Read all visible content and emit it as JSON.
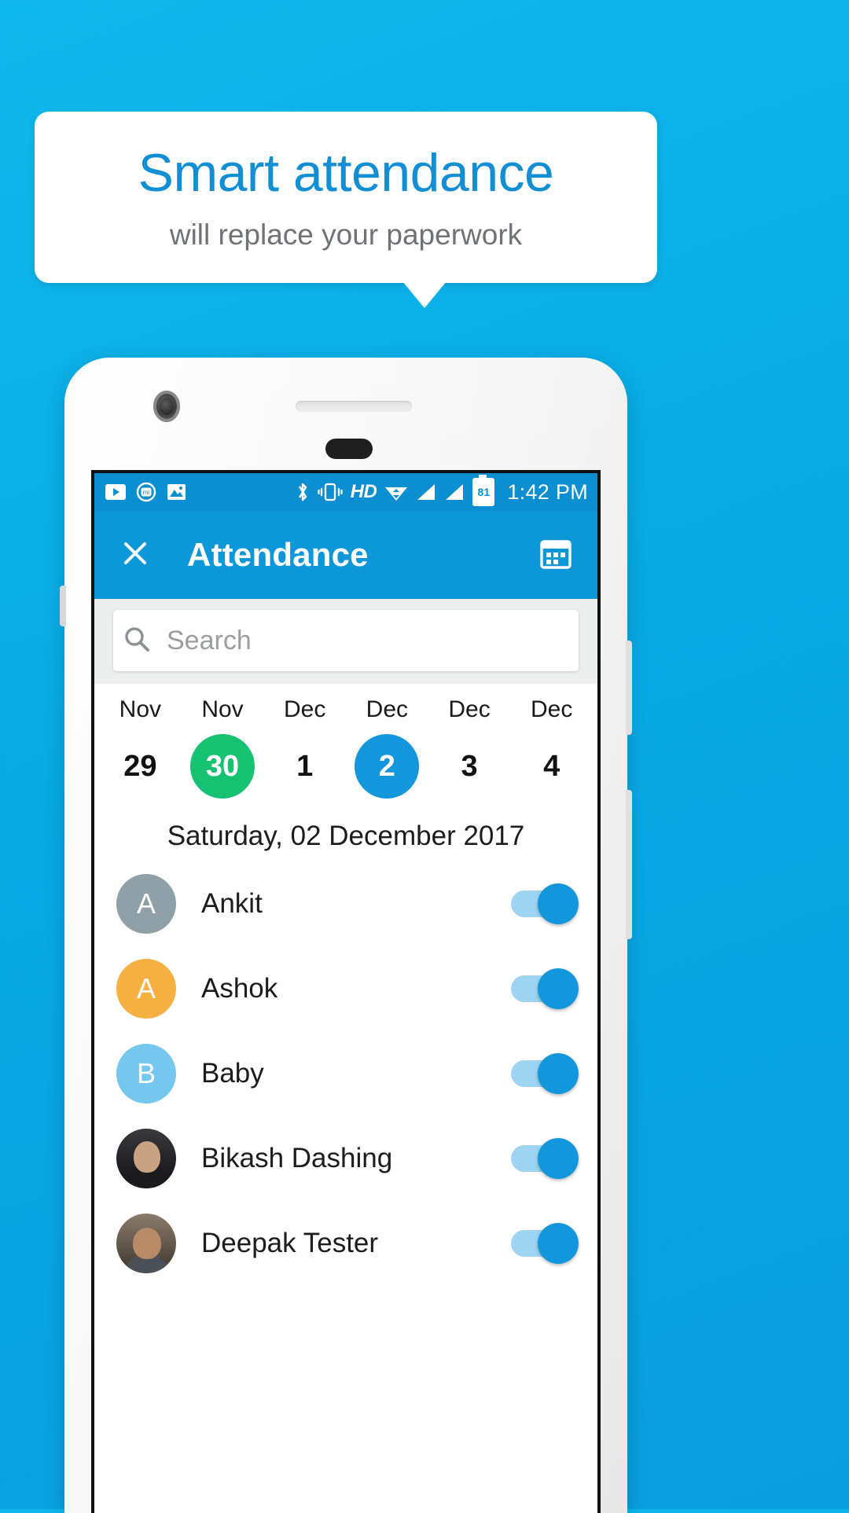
{
  "promo": {
    "headline": "Smart attendance",
    "subhead": "will replace your paperwork",
    "accent_color": "#128fd4",
    "background_color": "#0aaae4"
  },
  "status_bar": {
    "time": "1:42 PM",
    "battery_level": "81",
    "network_label": "HD",
    "left_icons": [
      "youtube-icon",
      "mi-camera-icon",
      "gallery-icon"
    ],
    "right_icons": [
      "bluetooth-icon",
      "vibrate-icon",
      "hd-icon",
      "wifi-icon",
      "signal-icon",
      "signal-icon",
      "battery-icon"
    ]
  },
  "app_bar": {
    "title": "Attendance",
    "close_icon": "close-icon",
    "calendar_icon": "calendar-icon",
    "background_color": "#0b97d8"
  },
  "search": {
    "placeholder": "Search",
    "value": "",
    "icon": "search-icon"
  },
  "date_strip": [
    {
      "month": "Nov",
      "day": "29",
      "state": "normal"
    },
    {
      "month": "Nov",
      "day": "30",
      "state": "today"
    },
    {
      "month": "Dec",
      "day": "1",
      "state": "normal"
    },
    {
      "month": "Dec",
      "day": "2",
      "state": "selected"
    },
    {
      "month": "Dec",
      "day": "3",
      "state": "normal"
    },
    {
      "month": "Dec",
      "day": "4",
      "state": "normal"
    }
  ],
  "selected_date_label": "Saturday, 02 December 2017",
  "colors": {
    "today_circle": "#16c172",
    "selected_circle": "#1496dc",
    "toggle_on_track": "#9ed4f2",
    "toggle_on_knob": "#1496dc"
  },
  "people": [
    {
      "name": "Ankit",
      "initial": "A",
      "avatar_type": "initial",
      "avatar_color": "#8fa0a8",
      "present": true
    },
    {
      "name": "Ashok",
      "initial": "A",
      "avatar_type": "initial",
      "avatar_color": "#f5b041",
      "present": true
    },
    {
      "name": "Baby",
      "initial": "B",
      "avatar_type": "initial",
      "avatar_color": "#76c7f0",
      "present": true
    },
    {
      "name": "Bikash Dashing",
      "initial": "",
      "avatar_type": "photo-dark",
      "avatar_color": "#232325",
      "present": true
    },
    {
      "name": "Deepak Tester",
      "initial": "",
      "avatar_type": "photo-light",
      "avatar_color": "#5d5247",
      "present": true
    }
  ]
}
